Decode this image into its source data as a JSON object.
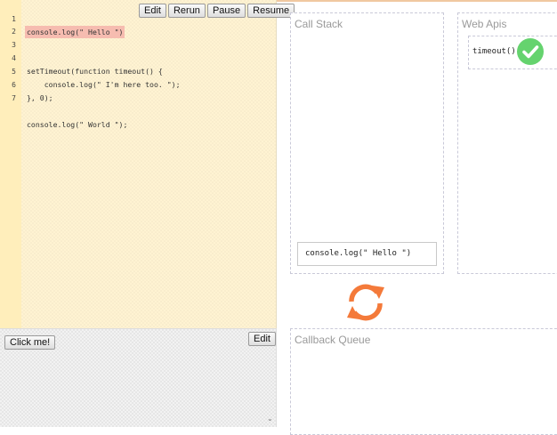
{
  "editor": {
    "lines": [
      {
        "num": "1",
        "code": "console.log(\" Hello \")"
      },
      {
        "num": "2",
        "code": ""
      },
      {
        "num": "3",
        "code": ""
      },
      {
        "num": "4",
        "code": "setTimeout(function timeout() {"
      },
      {
        "num": "5",
        "code": "    console.log(\" I'm here too. \");"
      },
      {
        "num": "6",
        "code": "}, 0);"
      },
      {
        "num": "7",
        "code": ""
      },
      {
        "num": "",
        "code": "console.log(\" World \");"
      }
    ],
    "toolbar": {
      "edit": "Edit",
      "rerun": "Rerun",
      "pause": "Pause",
      "resume": "Resume"
    }
  },
  "output": {
    "click_button": "Click me!",
    "edit": "Edit"
  },
  "call_stack": {
    "title": "Call Stack",
    "frames": [
      "console.log(\" Hello \")"
    ]
  },
  "web_apis": {
    "title": "Web Apis",
    "items": [
      "timeout()"
    ]
  },
  "callback_queue": {
    "title": "Callback Queue"
  },
  "colors": {
    "editor_bg": "#fff3d2",
    "highlight": "#f6bcb0",
    "event_loop": "#f47a3a",
    "check": "#65d36e"
  },
  "icons": {
    "event_loop": "refresh-arrows-icon",
    "done": "check-circle-icon"
  }
}
